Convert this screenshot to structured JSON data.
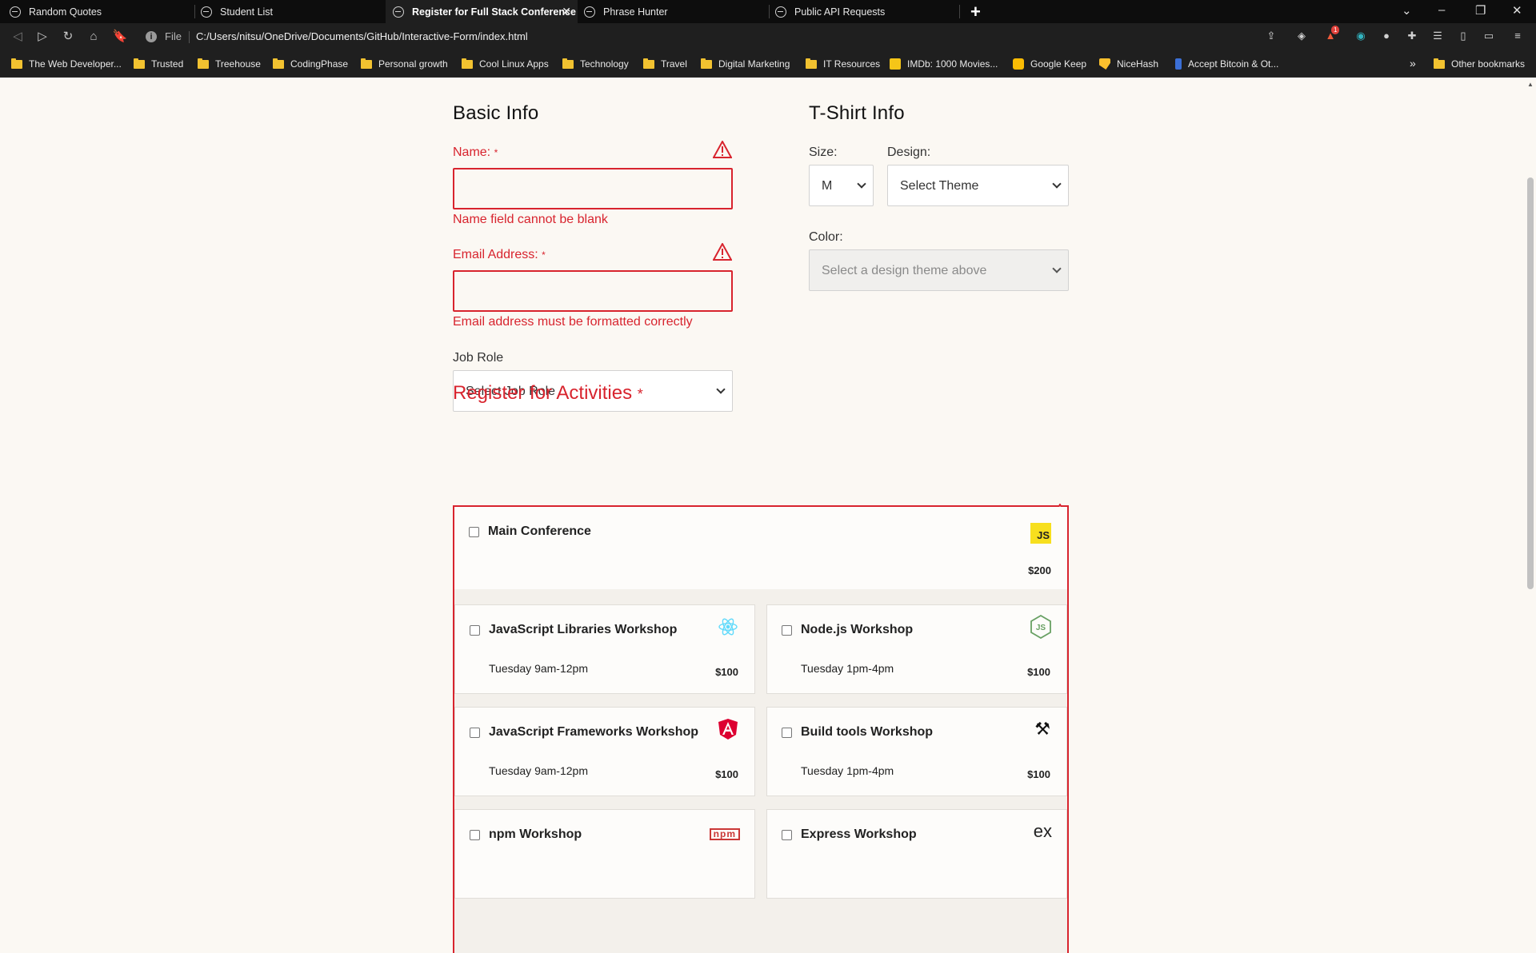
{
  "browser": {
    "tabs": [
      {
        "label": "Random Quotes"
      },
      {
        "label": "Student List"
      },
      {
        "label": "Register for Full Stack Conference",
        "active": true
      },
      {
        "label": "Phrase Hunter"
      },
      {
        "label": "Public API Requests"
      }
    ],
    "address": {
      "scheme_label": "File",
      "url": "C:/Users/nitsu/OneDrive/Documents/GitHub/Interactive-Form/index.html"
    },
    "bookmarks": [
      {
        "label": "The Web Developer...",
        "icon": "folder-icon"
      },
      {
        "label": "Trusted",
        "icon": "folder-icon"
      },
      {
        "label": "Treehouse",
        "icon": "folder-icon"
      },
      {
        "label": "CodingPhase",
        "icon": "folder-icon"
      },
      {
        "label": "Personal growth",
        "icon": "folder-icon"
      },
      {
        "label": "Cool Linux Apps",
        "icon": "folder-icon"
      },
      {
        "label": "Technology",
        "icon": "folder-icon"
      },
      {
        "label": "Travel",
        "icon": "folder-icon"
      },
      {
        "label": "Digital Marketing",
        "icon": "folder-icon"
      },
      {
        "label": "IT Resources",
        "icon": "folder-icon"
      },
      {
        "label": "IMDb: 1000 Movies...",
        "icon": "imdb-icon"
      },
      {
        "label": "Google Keep",
        "icon": "keep-icon"
      },
      {
        "label": "NiceHash",
        "icon": "nicehash-icon"
      },
      {
        "label": "Accept Bitcoin & Ot...",
        "icon": "bitcoin-icon"
      }
    ],
    "more_bookmarks": "»",
    "other_bookmarks": "Other bookmarks",
    "notification_count": "1"
  },
  "basic_info": {
    "title": "Basic Info",
    "name_label": "Name:",
    "name_required": "*",
    "name_error": "Name field cannot be blank",
    "email_label": "Email Address:",
    "email_required": "*",
    "email_error": "Email address must be formatted correctly",
    "job_role_label": "Job Role",
    "job_role_value": "Select Job Role"
  },
  "tshirt": {
    "title": "T-Shirt Info",
    "size_label": "Size:",
    "size_value": "M",
    "design_label": "Design:",
    "design_value": "Select Theme",
    "color_label": "Color:",
    "color_value": "Select a design theme above"
  },
  "activities": {
    "title": "Register for Activities",
    "required": "*",
    "items": [
      {
        "name": "Main Conference",
        "time": "",
        "price": "$200",
        "icon": "javascript-icon"
      },
      {
        "name": "JavaScript Libraries Workshop",
        "time": "Tuesday 9am-12pm",
        "price": "$100",
        "icon": "react-icon"
      },
      {
        "name": "Node.js Workshop",
        "time": "Tuesday 1pm-4pm",
        "price": "$100",
        "icon": "nodejs-icon"
      },
      {
        "name": "JavaScript Frameworks Workshop",
        "time": "Tuesday 9am-12pm",
        "price": "$100",
        "icon": "angular-icon"
      },
      {
        "name": "Build tools Workshop",
        "time": "Tuesday 1pm-4pm",
        "price": "$100",
        "icon": "tools-icon"
      },
      {
        "name": "npm Workshop",
        "time": "",
        "price": "",
        "icon": "npm-icon"
      },
      {
        "name": "Express Workshop",
        "time": "",
        "price": "",
        "icon": "express-icon"
      }
    ]
  },
  "icon_text": {
    "js": "JS",
    "npm": "npm",
    "express": "ex"
  },
  "colors": {
    "error": "#d8242e",
    "page_bg": "#fbf8f3",
    "js_yellow": "#f7df1e",
    "react_cyan": "#61dafb",
    "node_green": "#68a063",
    "angular_red": "#dd0031",
    "npm_red": "#cb3837"
  }
}
